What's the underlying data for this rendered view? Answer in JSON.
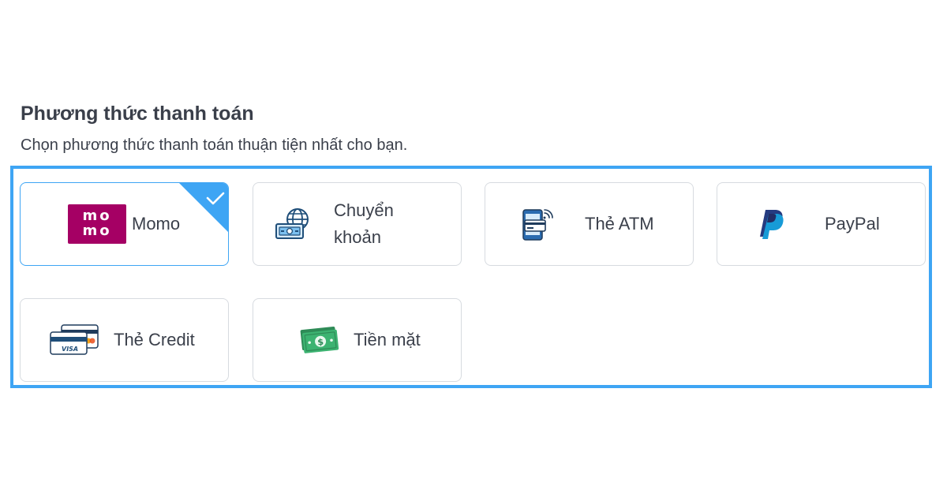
{
  "section": {
    "title": "Phương thức thanh toán",
    "subtitle": "Chọn phương thức thanh toán thuận tiện nhất cho bạn."
  },
  "methods": [
    {
      "label": "Momo",
      "icon": "momo-logo",
      "selected": true,
      "logo_text": [
        "mo",
        "mo"
      ]
    },
    {
      "label_lines": [
        "Chuyển",
        "khoản"
      ],
      "icon": "bank-transfer-icon",
      "selected": false
    },
    {
      "label": "Thẻ ATM",
      "icon": "atm-card-phone-icon",
      "selected": false
    },
    {
      "label": "PayPal",
      "icon": "paypal-icon",
      "selected": false
    },
    {
      "label": "Thẻ Credit",
      "icon": "credit-card-icon",
      "selected": false,
      "icon_text": "VISA"
    },
    {
      "label": "Tiền mặt",
      "icon": "cash-icon",
      "selected": false
    }
  ],
  "colors": {
    "accent": "#3ea5f4",
    "momo": "#a50064",
    "text": "#3a3f4a",
    "card_border": "#d7dbe0"
  }
}
